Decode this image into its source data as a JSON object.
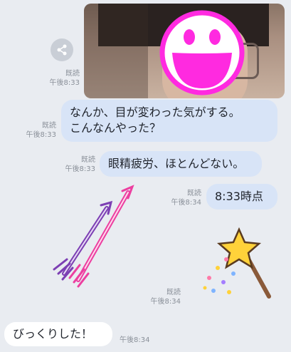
{
  "messages": [
    {
      "type": "image",
      "read": "既読",
      "time": "午後8:33",
      "icon": "share-icon"
    },
    {
      "type": "text",
      "line1": "なんか、目が変わった気がする。",
      "line2": "こんなんやった？",
      "read": "既読",
      "time": "午後8:33"
    },
    {
      "type": "text",
      "text": "眼精疲労、ほとんどない。",
      "read": "既読",
      "time": "午後8:33"
    },
    {
      "type": "text",
      "text": "8:33時点",
      "read": "既読",
      "time": "午後8:34"
    },
    {
      "type": "sticker",
      "sticker": "arrows",
      "read": "",
      "time": ""
    },
    {
      "type": "sticker",
      "sticker": "star-wand",
      "read": "既読",
      "time": "午後8:34"
    },
    {
      "type": "incoming",
      "text": "びっくりした！",
      "time": "午後8:34"
    }
  ],
  "colors": {
    "background": "#e9ecf1",
    "outgoing_bubble": "#d8e4f7",
    "incoming_bubble": "#ffffff",
    "smiley": "#ff2ae0"
  }
}
